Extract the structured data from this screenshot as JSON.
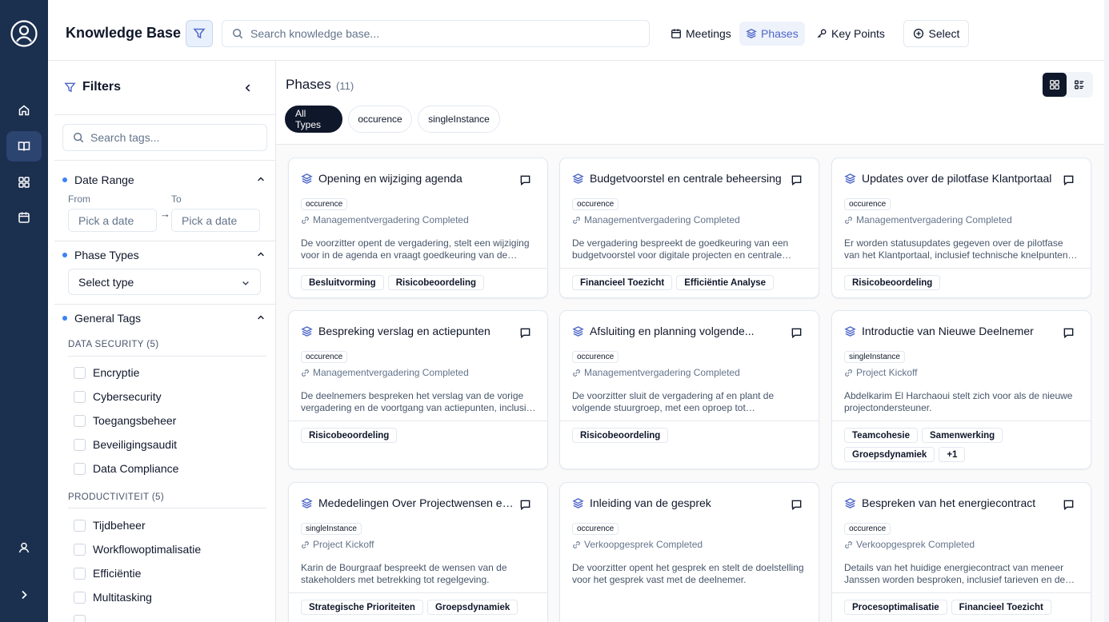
{
  "rail": {
    "icons": [
      "user-circle-icon",
      "home-icon",
      "book-open-icon",
      "grid-icon",
      "calendar-icon",
      "user-icon",
      "chevron-right-icon"
    ],
    "accent": "#1b2f4e"
  },
  "header": {
    "title": "Knowledge Base",
    "search_placeholder": "Search knowledge base...",
    "nav": [
      {
        "label": "Meetings",
        "icon": "calendar-icon"
      },
      {
        "label": "Phases",
        "icon": "layers-icon",
        "active": true
      },
      {
        "label": "Key Points",
        "icon": "key-icon"
      }
    ],
    "select_label": "Select"
  },
  "filters": {
    "title": "Filters",
    "tag_search_placeholder": "Search tags...",
    "date_range": {
      "label": "Date Range",
      "from_label": "From",
      "to_label": "To",
      "from_placeholder": "Pick a date",
      "to_placeholder": "Pick a date"
    },
    "phase_types": {
      "label": "Phase Types",
      "select_value": "Select type"
    },
    "general_tags": {
      "label": "General Tags",
      "groups": [
        {
          "label": "DATA SECURITY (5)",
          "items": [
            "Encryptie",
            "Cybersecurity",
            "Toegangsbeheer",
            "Beveiligingsaudit",
            "Data Compliance"
          ]
        },
        {
          "label": "PRODUCTIVITEIT (5)",
          "items": [
            "Tijdbeheer",
            "Workflowoptimalisatie",
            "Efficiëntie",
            "Multitasking"
          ]
        }
      ]
    }
  },
  "main": {
    "title": "Phases",
    "count": "(11)",
    "type_chips": [
      "All Types",
      "occurence",
      "singleInstance"
    ],
    "cards": [
      {
        "title": "Opening en wijziging agenda",
        "type": "occurence",
        "meeting": "Managementvergadering Completed",
        "description": "De voorzitter opent de vergadering, stelt een wijziging voor in de agenda en vraagt goedkeuring van de notulen van de vorige vergadering.",
        "tags": [
          "Besluitvorming",
          "Risicobeoordeling"
        ]
      },
      {
        "title": "Budgetvoorstel en centrale beheersing",
        "type": "occurence",
        "meeting": "Managementvergadering Completed",
        "description": "De vergadering bespreekt de goedkeuring van een budgetvoorstel voor digitale projecten en centrale beheersing.",
        "tags": [
          "Financieel Toezicht",
          "Efficiëntie Analyse"
        ]
      },
      {
        "title": "Updates over de pilotfase Klantportaal",
        "type": "occurence",
        "meeting": "Managementvergadering Completed",
        "description": "Er worden statusupdates gegeven over de pilotfase van het Klantportaal, inclusief technische knelpunten en de planning.",
        "tags": [
          "Risicobeoordeling"
        ]
      },
      {
        "title": "Bespreking verslag en actiepunten",
        "type": "occurence",
        "meeting": "Managementvergadering Completed",
        "description": "De deelnemers bespreken het verslag van de vorige vergadering en de voortgang van actiepunten, inclusief openstaande zaken.",
        "tags": [
          "Risicobeoordeling"
        ]
      },
      {
        "title": "Afsluiting en planning volgende...",
        "type": "occurence",
        "meeting": "Managementvergadering Completed",
        "description": "De voorzitter sluit de vergadering af en plant de volgende stuurgroep, met een oproep tot communicatie.",
        "tags": [
          "Risicobeoordeling"
        ]
      },
      {
        "title": "Introductie van Nieuwe Deelnemer",
        "type": "singleInstance",
        "meeting": "Project Kickoff",
        "description": "Abdelkarim El Harchaoui stelt zich voor als de nieuwe projectondersteuner.",
        "tags": [
          "Teamcohesie",
          "Samenwerking",
          "Groepsdynamiek",
          "+1"
        ]
      },
      {
        "title": "Mededelingen Over Projectwensen en...",
        "type": "singleInstance",
        "meeting": "Project Kickoff",
        "description": "Karin de Bourgraaf bespreekt de wensen van de stakeholders met betrekking tot regelgeving.",
        "tags": [
          "Strategische Prioriteiten",
          "Groepsdynamiek"
        ]
      },
      {
        "title": "Inleiding van de gesprek",
        "type": "occurence",
        "meeting": "Verkoopgesprek Completed",
        "description": "De voorzitter opent het gesprek en stelt de doelstelling voor het gesprek vast met de deelnemer.",
        "tags": []
      },
      {
        "title": "Bespreken van het energiecontract",
        "type": "occurence",
        "meeting": "Verkoopgesprek Completed",
        "description": "Details van het huidige energiecontract van meneer Janssen worden besproken, inclusief tarieven en de looptijd.",
        "tags": [
          "Procesoptimalisatie",
          "Financieel Toezicht"
        ]
      }
    ]
  }
}
